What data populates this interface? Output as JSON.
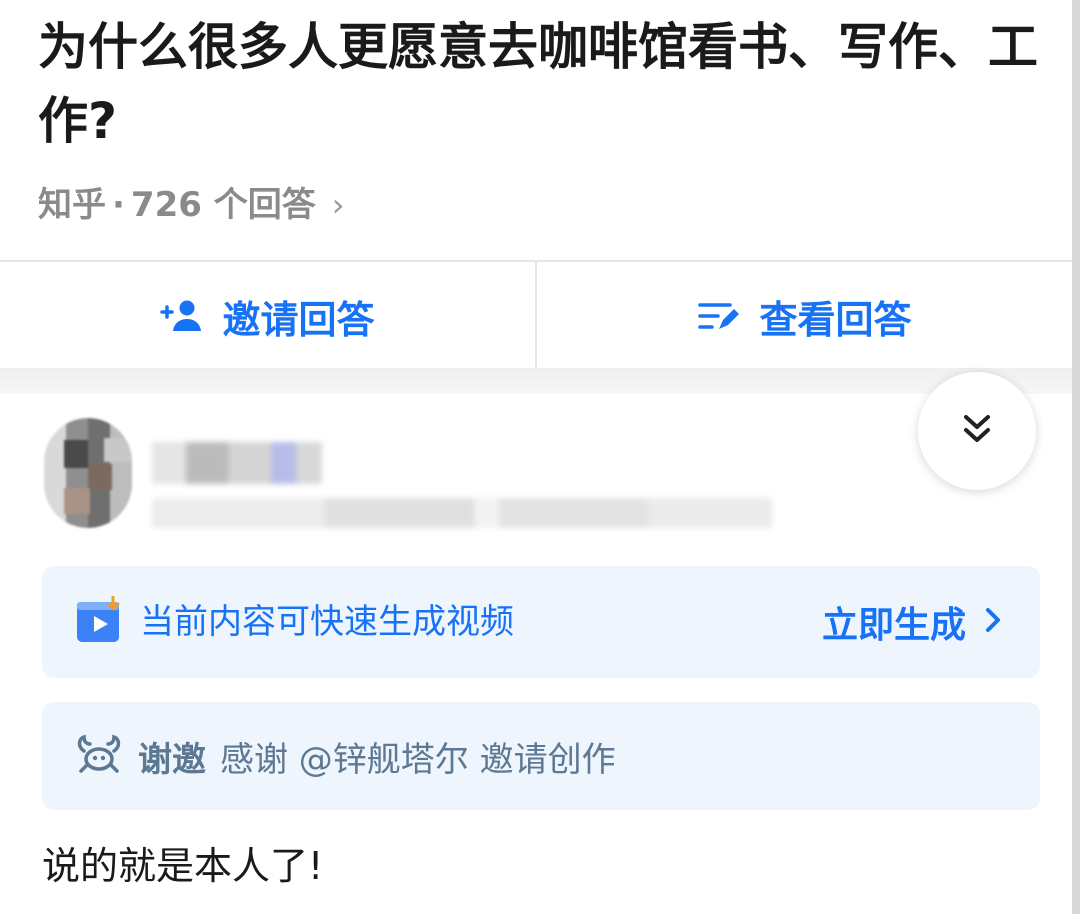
{
  "question": {
    "title": "为什么很多人更愿意去咖啡馆看书、写作、工作?",
    "source": "知乎",
    "separator": "·",
    "answer_count": "726 个回答"
  },
  "actions": {
    "invite_label": "邀请回答",
    "view_label": "查看回答"
  },
  "video_card": {
    "text": "当前内容可快速生成视频",
    "action_label": "立即生成"
  },
  "invite_card": {
    "label": "谢邀",
    "text": "感谢 @锌舰塔尔 邀请创作"
  },
  "answer": {
    "text": "说的就是本人了!"
  },
  "colors": {
    "accent": "#1772f6",
    "card_bg": "#eef5fd",
    "muted": "#8a8a8a"
  },
  "icons": {
    "invite": "add-person-icon",
    "view": "list-edit-icon",
    "collapse": "double-chevron-down-icon",
    "video": "video-play-icon",
    "invite_card": "crab-icon"
  }
}
